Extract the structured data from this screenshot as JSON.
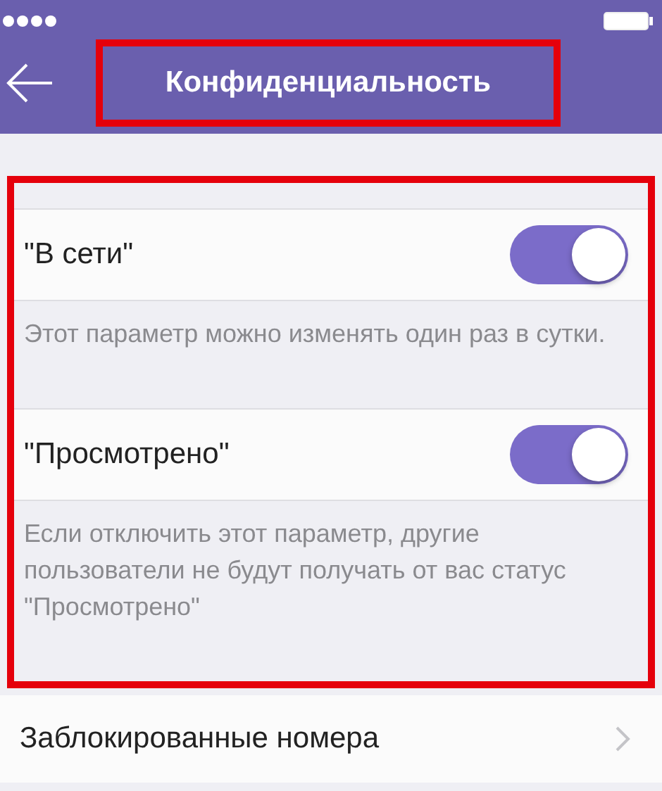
{
  "nav": {
    "title": "Конфиденциальность",
    "highlighted": true
  },
  "privacy": {
    "highlighted": true,
    "settings": [
      {
        "label": "\"В сети\"",
        "on": true,
        "description": "Этот параметр можно изменять один раз в сутки."
      },
      {
        "label": "\"Просмотрено\"",
        "on": true,
        "description": "Если отключить этот параметр, другие пользователи не будут получать от вас статус \"Просмотрено\""
      }
    ]
  },
  "links": [
    {
      "label": "Заблокированные номера"
    }
  ]
}
